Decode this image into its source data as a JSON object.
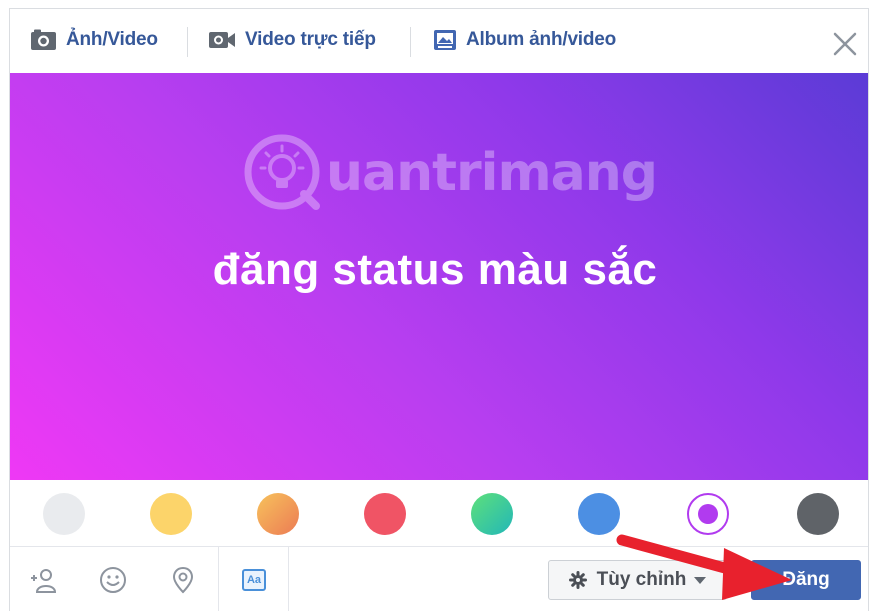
{
  "tabs": [
    {
      "label": "Ảnh/Video",
      "icon": "camera-icon"
    },
    {
      "label": "Video trực tiếp",
      "icon": "video-camera-icon"
    },
    {
      "label": "Album ảnh/video",
      "icon": "photo-album-icon"
    }
  ],
  "close_icon": "close-icon",
  "watermark": {
    "text": "uantrimang",
    "icon": "lightbulb-logo"
  },
  "status": {
    "text": "đăng status màu sắc"
  },
  "background_colors": [
    "#e9ebee",
    "#fcd46a",
    "#f49c55",
    "#f05465",
    "#2fcd9c",
    "#4c8fe3",
    "#b13bef",
    "#5f6368"
  ],
  "selected_color_index": 6,
  "toolbar": {
    "tag_friends_icon": "tag-friends-icon",
    "feeling_icon": "smiley-icon",
    "checkin_icon": "location-pin-icon",
    "text_style_icon": "text-style-aa-icon",
    "text_style_label": "Aa"
  },
  "custom_button": {
    "label": "Tùy chỉnh",
    "icon": "gear-icon"
  },
  "post_button": {
    "label": "Đăng"
  },
  "colors": {
    "accent": "#4267b2",
    "link": "#365899",
    "annotation_arrow": "#e8212d"
  }
}
